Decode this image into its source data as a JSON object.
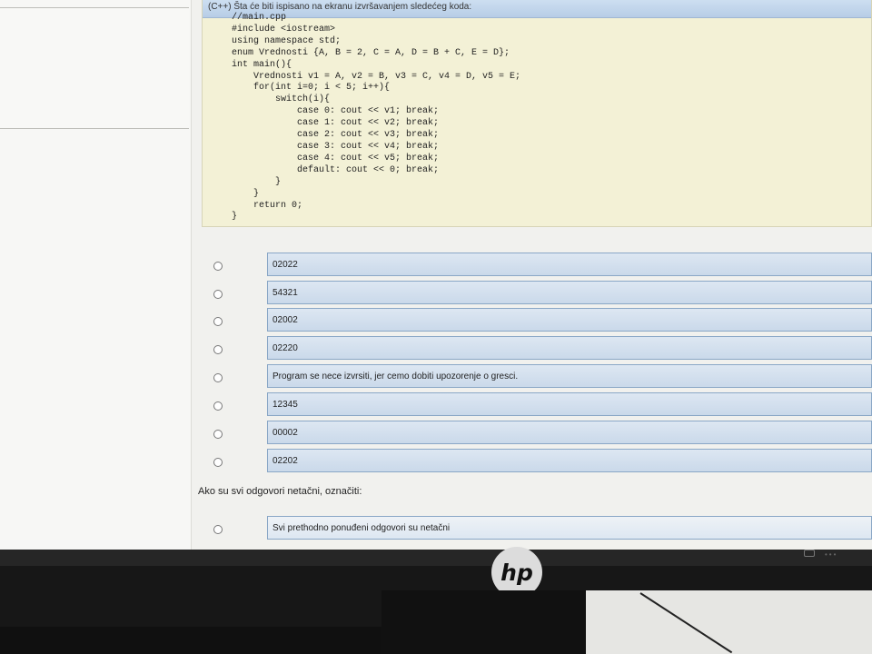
{
  "question": {
    "title": "(C++) Šta će biti ispisano na ekranu izvršavanjem sledećeg koda:",
    "code_lines": [
      "//main.cpp",
      "#include <iostream>",
      "using namespace std;",
      "enum Vrednosti {A, B = 2, C = A, D = B + C, E = D};",
      "int main(){",
      "    Vrednosti v1 = A, v2 = B, v3 = C, v4 = D, v5 = E;",
      "    for(int i=0; i < 5; i++){",
      "        switch(i){",
      "            case 0: cout << v1; break;",
      "            case 1: cout << v2; break;",
      "            case 2: cout << v3; break;",
      "            case 3: cout << v4; break;",
      "            case 4: cout << v5; break;",
      "            default: cout << 0; break;",
      "        }",
      "    }",
      "    return 0;",
      "}"
    ]
  },
  "answers": [
    {
      "label": "02022"
    },
    {
      "label": "54321"
    },
    {
      "label": "02002"
    },
    {
      "label": "02220"
    },
    {
      "label": "Program se nece izvrsiti, jer cemo dobiti upozorenje o gresci."
    },
    {
      "label": "12345"
    },
    {
      "label": "00002"
    },
    {
      "label": "02202"
    }
  ],
  "note": "Ako su svi odgovori netačni, označiti:",
  "final_answer": "Svi prethodno ponuđeni odgovori su netačni",
  "monitor": {
    "logo": "hp"
  }
}
